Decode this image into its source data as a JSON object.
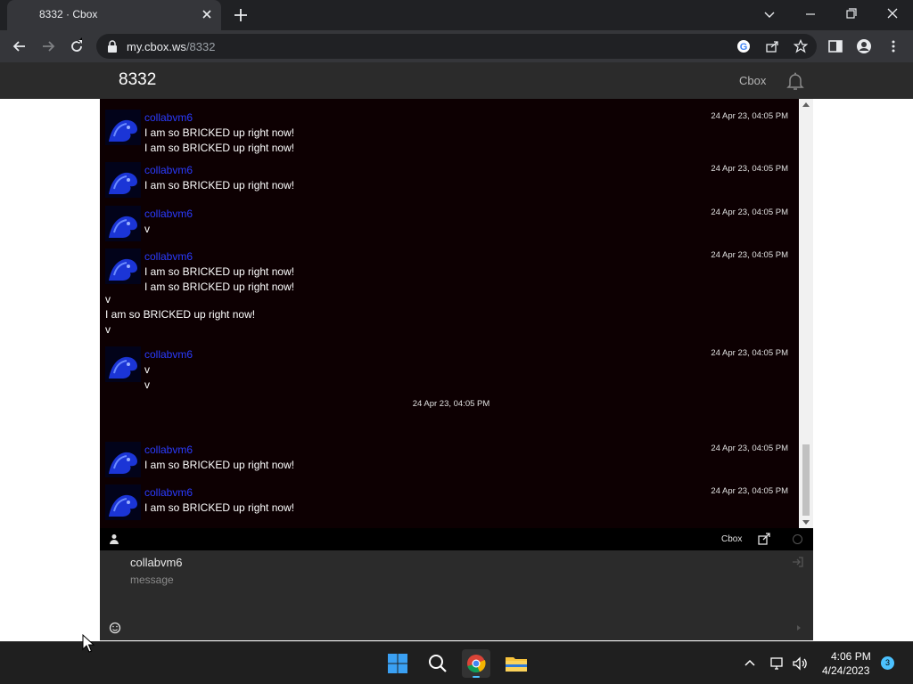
{
  "browser": {
    "tab_title": "8332 · Cbox",
    "url_host": "my.cbox.ws",
    "url_path": "/8332"
  },
  "page": {
    "title": "8332",
    "header_link": "Cbox"
  },
  "messages": [
    {
      "type": "user",
      "user": "collabvm6",
      "time": "24 Apr 23, 04:05 PM",
      "lines": [
        "I am so BRICKED up right now!",
        "I am so BRICKED up right now!"
      ]
    },
    {
      "type": "user",
      "user": "collabvm6",
      "time": "24 Apr 23, 04:05 PM",
      "lines": [
        "I am so BRICKED up right now!"
      ]
    },
    {
      "type": "user",
      "user": "collabvm6",
      "time": "24 Apr 23, 04:05 PM",
      "lines": [
        "v"
      ]
    },
    {
      "type": "user",
      "user": "collabvm6",
      "time": "24 Apr 23, 04:05 PM",
      "lines": [
        "I am so BRICKED up right now!",
        "I am so BRICKED up right now!"
      ]
    },
    {
      "type": "plain",
      "lines": [
        "v",
        "I am so BRICKED up right now!",
        "v"
      ]
    },
    {
      "type": "user",
      "user": "collabvm6",
      "time": "24 Apr 23, 04:05 PM",
      "lines": [
        "v",
        "v"
      ]
    },
    {
      "type": "system",
      "time": "24 Apr 23, 04:05 PM"
    },
    {
      "type": "user",
      "user": "collabvm6",
      "time": "24 Apr 23, 04:05 PM",
      "lines": [
        "I am so BRICKED up right now!"
      ]
    },
    {
      "type": "user",
      "user": "collabvm6",
      "time": "24 Apr 23, 04:05 PM",
      "lines": [
        "I am so BRICKED up right now!"
      ]
    }
  ],
  "chat_footer": {
    "cbox_label": "Cbox"
  },
  "compose": {
    "name_value": "collabvm6",
    "message_placeholder": "message"
  },
  "taskbar": {
    "time": "4:06 PM",
    "date": "4/24/2023",
    "notification_count": "3"
  },
  "colors": {
    "chat_bg": "#0d0002",
    "username": "#2b3bff",
    "header_bg": "#2b2b2b"
  }
}
